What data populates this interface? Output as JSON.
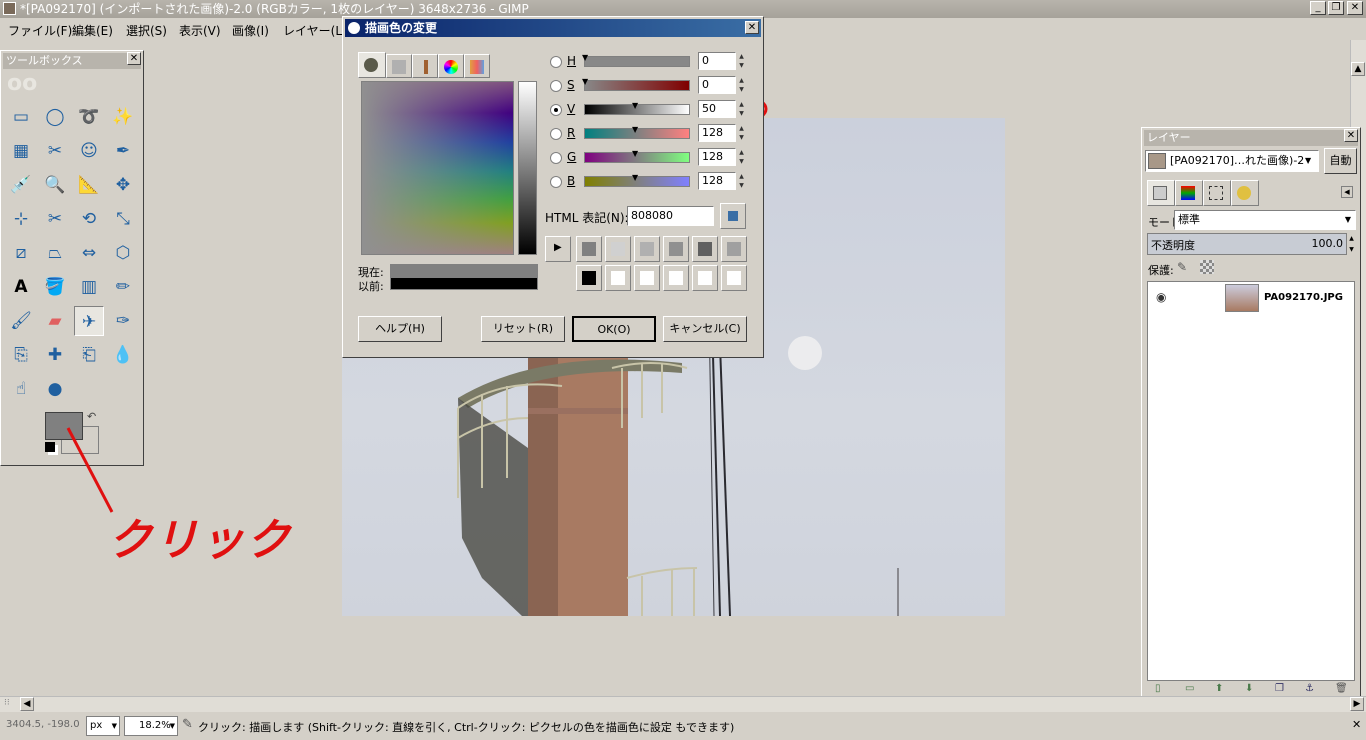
{
  "window": {
    "title": "*[PA092170] (インポートされた画像)-2.0 (RGBカラー, 1枚のレイヤー) 3648x2736 - GIMP"
  },
  "menu": [
    "ファイル(F)",
    "編集(E)",
    "選択(S)",
    "表示(V)",
    "画像(I)",
    "レイヤー(L)"
  ],
  "toolbox": {
    "title": "ツールボックス",
    "tools": [
      "rect-select",
      "ellipse-select",
      "free-select",
      "fuzzy-select",
      "select-by-color",
      "scissors",
      "foreground-select",
      "paths",
      "color-picker",
      "zoom",
      "measure",
      "move",
      "align",
      "crop",
      "rotate",
      "scale",
      "shear",
      "perspective",
      "flip",
      "cage",
      "text",
      "bucket-fill",
      "blend",
      "pencil",
      "paintbrush",
      "eraser",
      "airbrush",
      "ink",
      "clone",
      "heal",
      "perspective-clone",
      "blur",
      "smudge",
      "dodge-burn"
    ],
    "fg_color": "#808080",
    "bg_color": "#ffffff"
  },
  "annotation": {
    "text": "クリック",
    "color": "#e01010"
  },
  "dialog": {
    "title": "描画色の変更",
    "channels": [
      {
        "label": "H",
        "value": "0"
      },
      {
        "label": "S",
        "value": "0"
      },
      {
        "label": "V",
        "value": "50"
      },
      {
        "label": "R",
        "value": "128"
      },
      {
        "label": "G",
        "value": "128"
      },
      {
        "label": "B",
        "value": "128"
      }
    ],
    "selected_channel": "V",
    "html_label": "HTML 表記(N):",
    "html_value": "808080",
    "current_label": "現在:",
    "old_label": "以前:",
    "help": "ヘルプ(H)",
    "reset": "リセット(R)",
    "ok": "OK(O)",
    "cancel": "キャンセル(C)",
    "current_color": "#808080",
    "old_color": "#000000",
    "history": [
      "#808080",
      "#d0d0d0",
      "#b0b0b0",
      "#909090",
      "#606060",
      "#a0a0a0",
      "#000000",
      "#ffffff",
      "#ffffff",
      "#ffffff",
      "#ffffff",
      "#ffffff"
    ]
  },
  "layers": {
    "title": "レイヤー",
    "image_select": "[PA092170]…れた画像)-2",
    "auto": "自動",
    "mode_label": "モード",
    "mode_value": "標準",
    "opacity_label": "不透明度",
    "opacity_value": "100.0",
    "lock_label": "保護:",
    "layer_name": "PA092170.JPG"
  },
  "status": {
    "coords": "3404.5, -198.0",
    "unit": "px",
    "zoom": "18.2%",
    "message": "クリック: 描画します (Shift-クリック: 直線を引く, Ctrl-クリック: ピクセルの色を描画色に設定 もできます)"
  }
}
